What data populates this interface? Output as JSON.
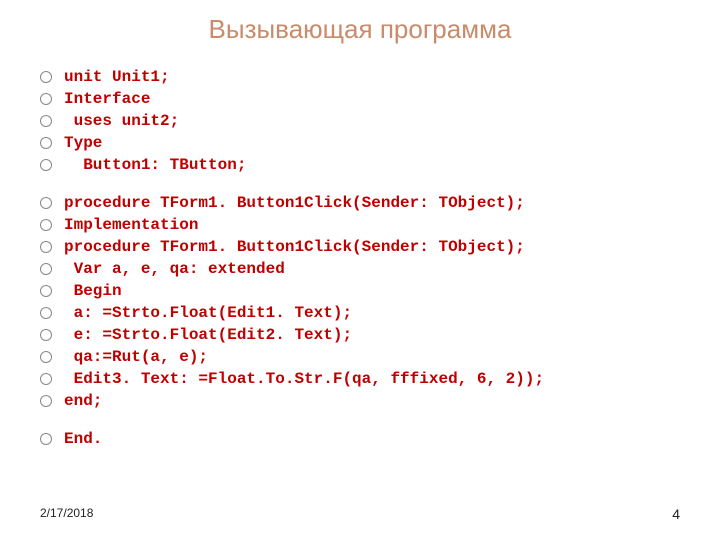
{
  "title": "Вызывающая программа",
  "groups": [
    [
      "unit Unit1;",
      "Interface",
      " uses unit2;",
      "Type",
      "  Button1: TButton;"
    ],
    [
      "procedure TForm1. Button1Click(Sender: TObject);",
      "Implementation",
      "procedure TForm1. Button1Click(Sender: TObject);",
      " Var a, e, qa: extended",
      " Begin",
      " a: =Strto.Float(Edit1. Text);",
      " e: =Strto.Float(Edit2. Text);",
      " qa:=Rut(a, e);",
      " Edit3. Text: =Float.To.Str.F(qa, fffixed, 6, 2));",
      "end;"
    ],
    [
      "End."
    ]
  ],
  "footer": {
    "date": "2/17/2018",
    "page": "4"
  }
}
